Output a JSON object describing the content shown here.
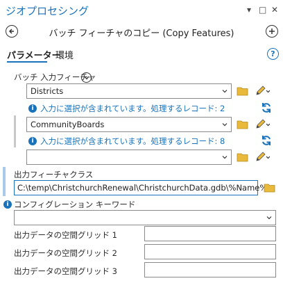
{
  "window": {
    "title": "ジオプロセシング",
    "controls": [
      "▾",
      "□",
      "✕"
    ]
  },
  "tool": {
    "title": "バッチ フィーチャのコピー (Copy Features)"
  },
  "tabs": [
    {
      "label": "パラメーター",
      "active": true
    },
    {
      "label": "環境",
      "active": false
    }
  ],
  "batch_input": {
    "label": "バッチ 入力フィーチャ",
    "items": [
      {
        "value": "Districts",
        "info": "入力に選択が含まれています。処理するレコード: 2"
      },
      {
        "value": "CommunityBoards",
        "info": "入力に選択が含まれています。処理するレコード: 8"
      },
      {
        "value": "",
        "info": ""
      }
    ]
  },
  "output": {
    "label": "出力フィーチャクラス",
    "value": "C:\\temp\\ChristchurchRenewal\\ChristchurchData.gdb\\%Name%"
  },
  "config": {
    "label": "コンフィグレーション キーワード",
    "value": ""
  },
  "spatial_grids": [
    {
      "label": "出力データの空間グリッド 1",
      "value": ""
    },
    {
      "label": "出力データの空間グリッド 2",
      "value": ""
    },
    {
      "label": "出力データの空間グリッド 3",
      "value": ""
    }
  ],
  "icons": {
    "back": "back-arrow-icon",
    "add": "plus-icon",
    "help": "help-icon",
    "folder": "folder-icon",
    "pencil": "pencil-icon",
    "info": "info-icon",
    "refresh": "refresh-icon"
  },
  "colors": {
    "accent": "#1a72bb",
    "folder": "#e8b93b"
  }
}
